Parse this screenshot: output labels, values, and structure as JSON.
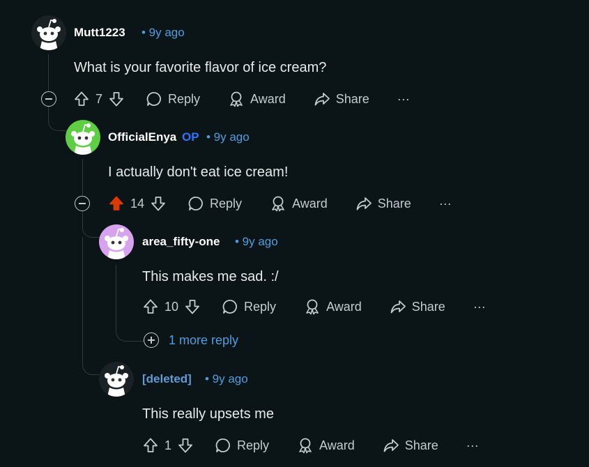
{
  "comments": [
    {
      "username": "Mutt1223",
      "time": "• 9y ago",
      "text": "What is your favorite flavor of ice cream?",
      "votes": "7",
      "reply": "Reply",
      "award": "Award",
      "share": "Share",
      "more": "···"
    },
    {
      "username": "OfficialEnya",
      "badge": "OP",
      "time": "• 9y ago",
      "text": "I actually don't eat ice cream!",
      "votes": "14",
      "reply": "Reply",
      "award": "Award",
      "share": "Share",
      "more": "···"
    },
    {
      "username": "area_fifty-one",
      "time": "• 9y ago",
      "text": "This makes me sad. :/",
      "votes": "10",
      "reply": "Reply",
      "award": "Award",
      "share": "Share",
      "more": "···"
    },
    {
      "username": "[deleted]",
      "time": "• 9y ago",
      "text": "This really upsets me",
      "votes": "1",
      "reply": "Reply",
      "award": "Award",
      "share": "Share",
      "more": "···"
    }
  ],
  "more_replies": "1 more reply",
  "colors": {
    "background": "#0b1416",
    "upvote_active": "#d93a00",
    "link": "#4f9fe0",
    "op_badge": "#2f74ff",
    "avatar_green": "#5fce45",
    "avatar_purple": "#d7a3ee"
  }
}
